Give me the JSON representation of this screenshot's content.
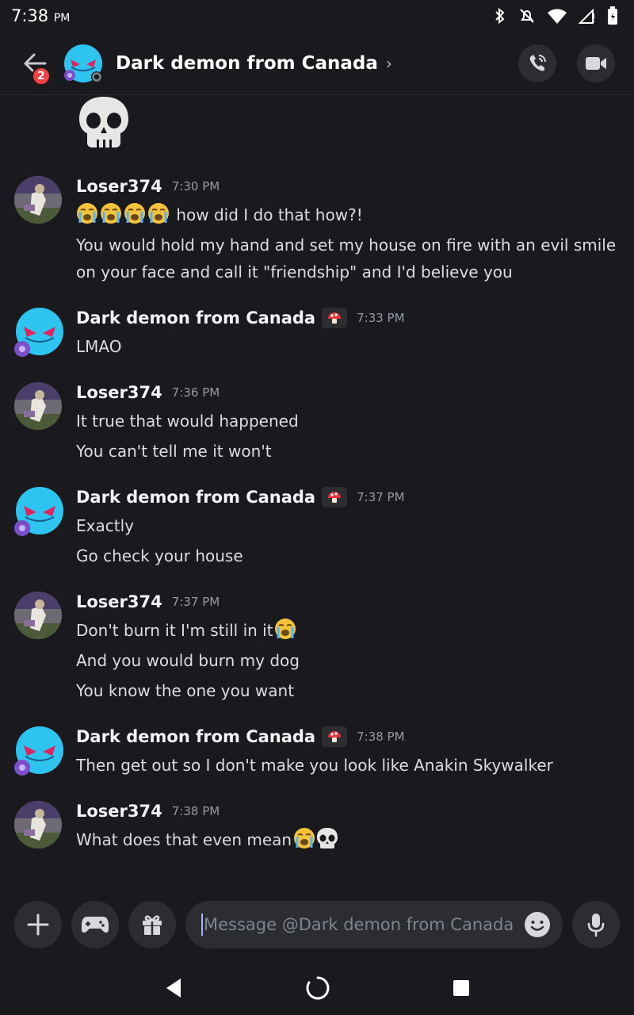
{
  "status_bar": {
    "time": "7:38",
    "ampm": "PM"
  },
  "header": {
    "back_badge": "2",
    "title": "Dark demon from Canada",
    "chevron": "›"
  },
  "messages": [
    {
      "user": "Loser374",
      "time": "7:30 PM",
      "kind": "loser",
      "lines": [
        "how did I do that how?!",
        "You would hold my hand and set my house on fire with an evil smile",
        "on your face and call it \"friendship\" and I'd believe you"
      ]
    },
    {
      "user": "Dark demon from Canada",
      "time": "7:33 PM",
      "kind": "demon",
      "lines": [
        "LMAO"
      ]
    },
    {
      "user": "Loser374",
      "time": "7:36 PM",
      "kind": "loser",
      "lines": [
        "It true that would happened",
        "You can't tell me it won't"
      ]
    },
    {
      "user": "Dark demon from Canada",
      "time": "7:37 PM",
      "kind": "demon",
      "lines": [
        "Exactly",
        "Go check your house"
      ]
    },
    {
      "user": "Loser374",
      "time": "7:37 PM",
      "kind": "loser",
      "lines": [
        "Don't burn it I'm still in it",
        "And you would burn my dog",
        "You know the one you want"
      ]
    },
    {
      "user": "Dark demon from Canada",
      "time": "7:38 PM",
      "kind": "demon",
      "lines": [
        "Then get out so I don't make you look like Anakin Skywalker"
      ]
    },
    {
      "user": "Loser374",
      "time": "7:38 PM",
      "kind": "loser",
      "lines": [
        "What does that even mean"
      ]
    }
  ],
  "composer": {
    "placeholder": "Message @Dark demon from Canada"
  },
  "colors": {
    "bg": "#1a1a1e",
    "accent_cyan": "#2ec4f0",
    "badge_red": "#f23f42",
    "emoji_yellow": "#f5c33b"
  },
  "icons": [
    "back-arrow-icon",
    "phone-call-icon",
    "video-camera-icon",
    "skull-icon",
    "crying-emoji-icon",
    "mushroom-icon",
    "plus-icon",
    "gamepad-icon",
    "gift-icon",
    "smile-icon",
    "microphone-icon",
    "nav-back-icon",
    "nav-home-icon",
    "nav-recents-icon"
  ]
}
